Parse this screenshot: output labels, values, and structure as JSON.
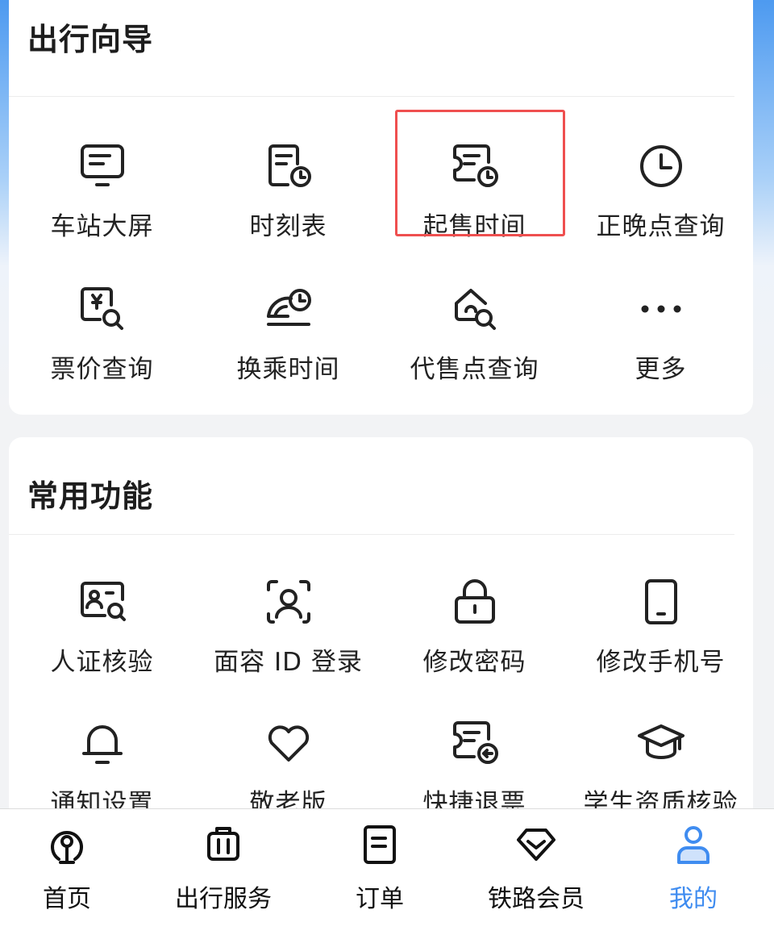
{
  "travel_guide": {
    "title": "出行向导",
    "items": [
      {
        "label": "车站大屏",
        "icon": "station-screen-icon"
      },
      {
        "label": "时刻表",
        "icon": "timetable-icon"
      },
      {
        "label": "起售时间",
        "icon": "sale-time-icon"
      },
      {
        "label": "正晚点查询",
        "icon": "clock-icon"
      },
      {
        "label": "票价查询",
        "icon": "fare-query-icon"
      },
      {
        "label": "换乘时间",
        "icon": "transfer-time-icon"
      },
      {
        "label": "代售点查询",
        "icon": "agency-query-icon"
      },
      {
        "label": "更多",
        "icon": "more-icon"
      }
    ]
  },
  "common_functions": {
    "title": "常用功能",
    "items": [
      {
        "label": "人证核验",
        "icon": "id-verify-icon"
      },
      {
        "label": "面容 ID 登录",
        "icon": "face-id-icon"
      },
      {
        "label": "修改密码",
        "icon": "lock-icon"
      },
      {
        "label": "修改手机号",
        "icon": "phone-icon"
      },
      {
        "label": "通知设置",
        "icon": "bell-icon"
      },
      {
        "label": "敬老版",
        "icon": "heart-icon"
      },
      {
        "label": "快捷退票",
        "icon": "refund-ticket-icon"
      },
      {
        "label": "学生资质核验",
        "icon": "graduation-cap-icon"
      }
    ]
  },
  "tabbar": {
    "tabs": [
      {
        "label": "首页",
        "icon": "railway-logo-icon"
      },
      {
        "label": "出行服务",
        "icon": "luggage-icon"
      },
      {
        "label": "订单",
        "icon": "order-list-icon"
      },
      {
        "label": "铁路会员",
        "icon": "diamond-icon"
      },
      {
        "label": "我的",
        "icon": "person-icon",
        "active": true
      }
    ]
  },
  "colors": {
    "accent": "#3f8cf0",
    "highlight_border": "#ef4f4f",
    "header_gradient_top": "#4d9af0"
  }
}
